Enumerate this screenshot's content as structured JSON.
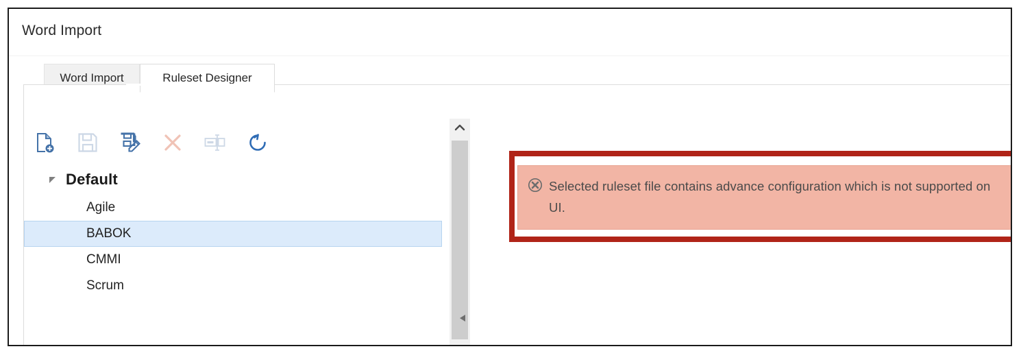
{
  "window": {
    "title": "Word Import"
  },
  "tabs": [
    {
      "label": "Word Import",
      "active": false,
      "name": "tab-word-import"
    },
    {
      "label": "Ruleset Designer",
      "active": true,
      "name": "tab-ruleset-designer"
    }
  ],
  "toolbar": {
    "buttons": [
      {
        "icon": "new-ruleset-icon",
        "label": "New Ruleset",
        "enabled": true,
        "color": "#4472a8"
      },
      {
        "icon": "save-icon",
        "label": "Save",
        "enabled": false,
        "color": "#cdd8e6"
      },
      {
        "icon": "save-as-icon",
        "label": "Save As",
        "enabled": true,
        "color": "#4472a8"
      },
      {
        "icon": "delete-icon",
        "label": "Delete",
        "enabled": false,
        "color": "#f0c3b6"
      },
      {
        "icon": "rename-icon",
        "label": "Rename",
        "enabled": false,
        "color": "#cdd8e6"
      },
      {
        "icon": "refresh-icon",
        "label": "Refresh",
        "enabled": true,
        "color": "#2f6cb5"
      }
    ]
  },
  "tree": {
    "root": {
      "label": "Default",
      "expanded": true
    },
    "children": [
      {
        "label": "Agile",
        "selected": false
      },
      {
        "label": "BABOK",
        "selected": true
      },
      {
        "label": "CMMI",
        "selected": false
      },
      {
        "label": "Scrum",
        "selected": false
      }
    ]
  },
  "scrollbar": {
    "up_arrow": "chevron-up-icon",
    "h_left_arrow": "triangle-left-icon"
  },
  "error": {
    "icon": "error-circle-x-icon",
    "message": "Selected ruleset file contains advance configuration which is not supported on UI.",
    "border_color": "#b02418",
    "background_color": "#f2b5a5",
    "text_color": "#4a4a4a"
  },
  "colors": {
    "selection_bg": "#dcebfb",
    "selection_border": "#b6d4f0",
    "accent_blue": "#4472a8",
    "window_border": "#1a1a1a"
  }
}
